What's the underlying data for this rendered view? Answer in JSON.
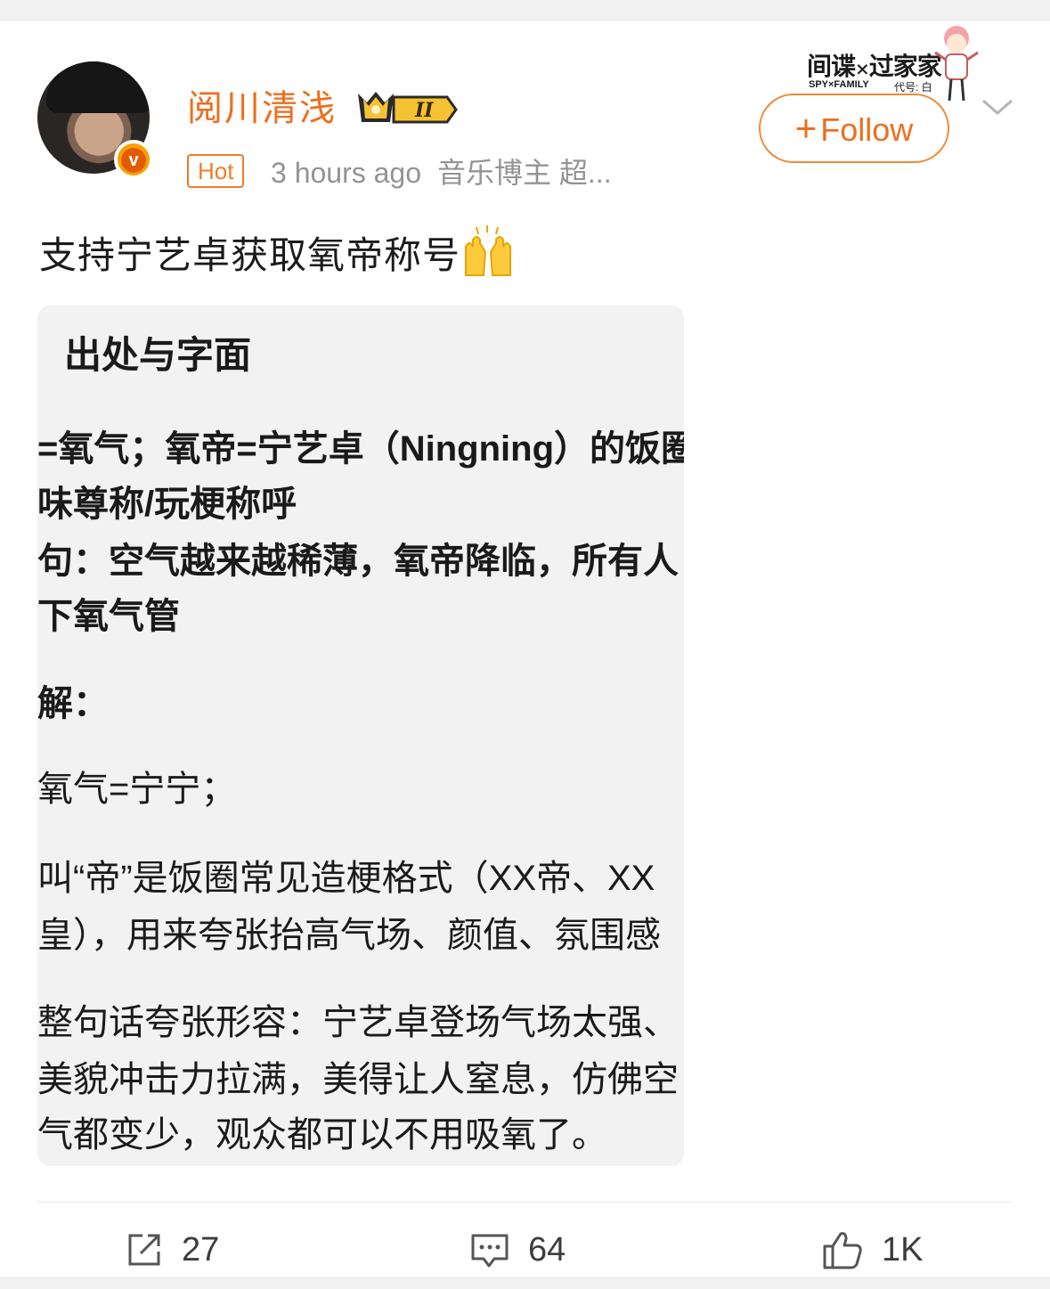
{
  "user": {
    "name": "阅川清浅",
    "badge_level": "II",
    "tag": "Hot",
    "time": "3 hours ago",
    "source": "音乐博主 超..."
  },
  "brand": {
    "title_a": "间谍",
    "title_x": "×",
    "title_b": "过家家",
    "sub_left": "SPY×FAMILY",
    "sub_right": "代号: 白"
  },
  "follow": {
    "plus": "+",
    "label": "Follow"
  },
  "post": {
    "text": "支持宁艺卓获取氧帝称号",
    "emoji": "raising-hands-emoji"
  },
  "image": {
    "heading": "出处与字面",
    "lines": [
      "=氧气；氧帝=宁艺卓（Ningning）的饭圈",
      "味尊称/玩梗称呼",
      "句：空气越来越稀薄，氧帝降临，所有人",
      "下氧气管",
      "解：",
      "氧气=宁宁；",
      "叫“帝”是饭圈常见造梗格式（XX帝、XX",
      "皇），用来夸张抬高气场、颜值、氛围感",
      "整句话夸张形容：宁艺卓登场气场太强、",
      "美貌冲击力拉满，美得让人窒息，仿佛空",
      "气都变少，观众都可以不用吸氧了。"
    ]
  },
  "actions": {
    "repost_count": "27",
    "comment_count": "64",
    "like_count": "1K"
  },
  "colors": {
    "accent": "#ee6e1d",
    "text": "#1b1b1b",
    "meta": "#939393",
    "image_bg": "#f2f2f2"
  }
}
